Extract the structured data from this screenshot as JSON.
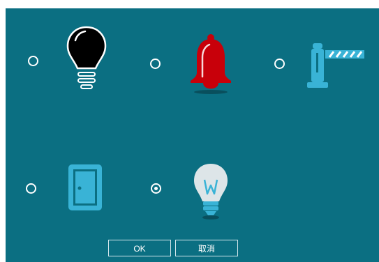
{
  "dialog": {
    "options": [
      {
        "icon": "lightbulb-black-icon",
        "selected": false
      },
      {
        "icon": "bell-red-icon",
        "selected": false
      },
      {
        "icon": "barrier-gate-icon",
        "selected": false
      },
      {
        "icon": "door-icon",
        "selected": false
      },
      {
        "icon": "lightbulb-outline-icon",
        "selected": true
      }
    ],
    "buttons": {
      "ok_label": "OK",
      "cancel_label": "取消"
    },
    "colors": {
      "background": "#0b6f82",
      "accent": "#39b3d6",
      "bell": "#c8000a"
    }
  }
}
